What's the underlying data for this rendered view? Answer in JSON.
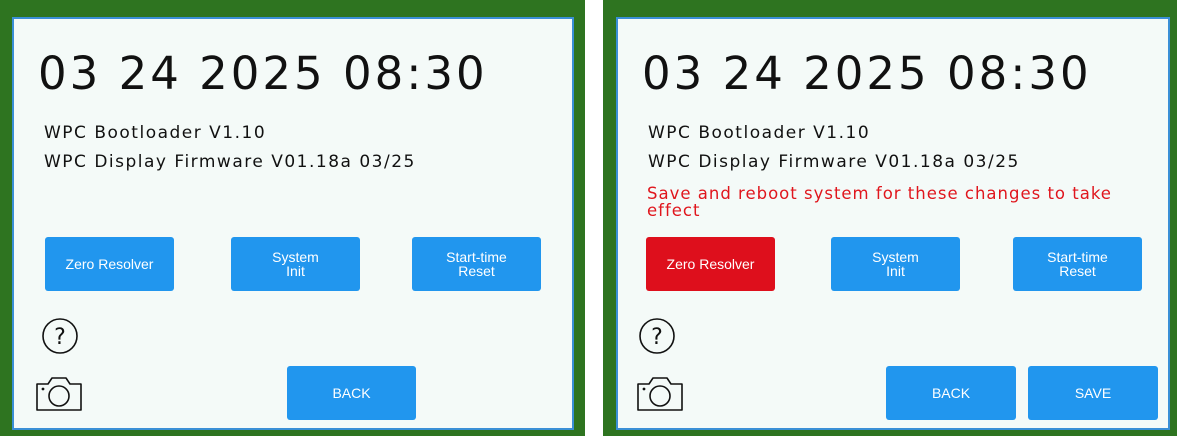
{
  "colors": {
    "frame": "#2e7420",
    "screen_bg": "#f4faf8",
    "button_blue": "#2196ee",
    "button_red": "#de0f1c",
    "warning_red": "#e0161d"
  },
  "left_panel": {
    "datetime": "03 24 2025 08:30",
    "bootloader": "WPC Bootloader   V1.10",
    "firmware": "WPC Display Firmware V01.18a 03/25",
    "buttons": {
      "zero_resolver": "Zero Resolver",
      "system_init": "System\nInit",
      "start_time_reset": "Start-time\nReset",
      "back": "BACK"
    },
    "icons": [
      "help-icon",
      "camera-icon"
    ]
  },
  "right_panel": {
    "datetime": "03 24 2025 08:30",
    "bootloader": "WPC Bootloader   V1.10",
    "firmware": "WPC Display Firmware V01.18a 03/25",
    "warning": "Save and reboot system for these changes to take effect",
    "buttons": {
      "zero_resolver": "Zero Resolver",
      "system_init": "System\nInit",
      "start_time_reset": "Start-time\nReset",
      "back": "BACK",
      "save": "SAVE"
    },
    "icons": [
      "help-icon",
      "camera-icon"
    ]
  }
}
